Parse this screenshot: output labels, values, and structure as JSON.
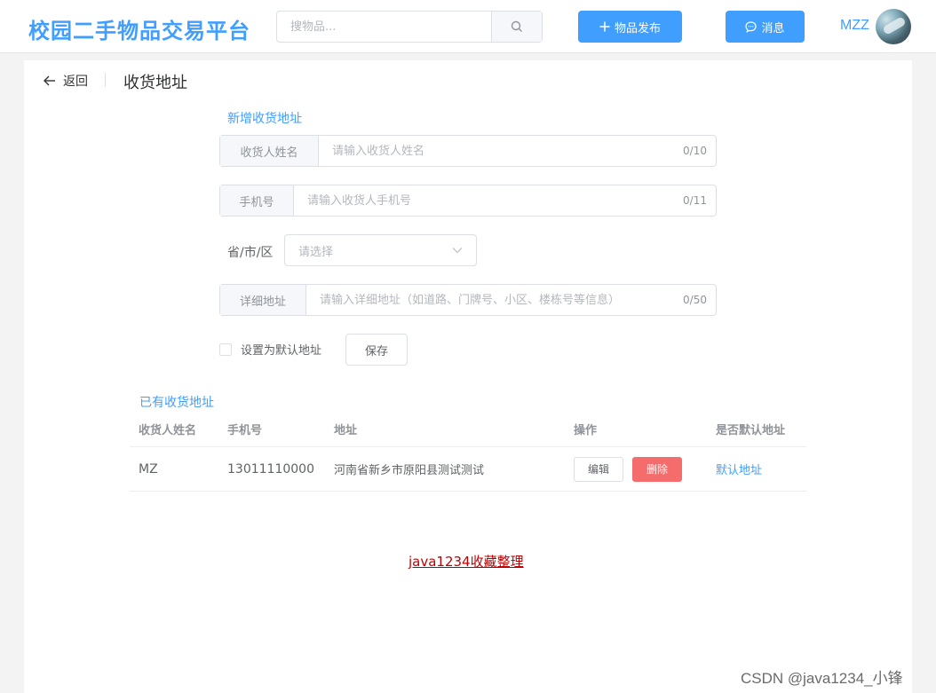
{
  "header": {
    "logo": "校园二手物品交易平台",
    "search_placeholder": "搜物品...",
    "publish_label": "物品发布",
    "message_label": "消息",
    "username": "MZZ"
  },
  "page": {
    "back_label": "返回",
    "title": "收货地址"
  },
  "form": {
    "section_title": "新增收货地址",
    "name": {
      "label": "收货人姓名",
      "placeholder": "请输入收货人姓名",
      "count": "0/10"
    },
    "phone": {
      "label": "手机号",
      "placeholder": "请输入收货人手机号",
      "count": "0/11"
    },
    "region": {
      "label": "省/市/区",
      "placeholder": "请选择"
    },
    "detail": {
      "label": "详细地址",
      "placeholder": "请输入详细地址（如道路、门牌号、小区、楼栋号等信息）",
      "count": "0/50"
    },
    "default_checkbox_label": "设置为默认地址",
    "save_label": "保存"
  },
  "existing": {
    "section_title": "已有收货地址",
    "columns": [
      "收货人姓名",
      "手机号",
      "地址",
      "操作",
      "是否默认地址"
    ],
    "rows": [
      {
        "name": "MZ",
        "phone": "13011110000",
        "address": "河南省新乡市原阳县测试测试",
        "edit": "编辑",
        "delete": "删除",
        "default": "默认地址"
      }
    ]
  },
  "footer_link": "java1234收藏整理",
  "watermark": "CSDN @java1234_小锋",
  "colors": {
    "primary": "#409eff",
    "danger": "#f56c6c",
    "link_red": "#c00000"
  }
}
